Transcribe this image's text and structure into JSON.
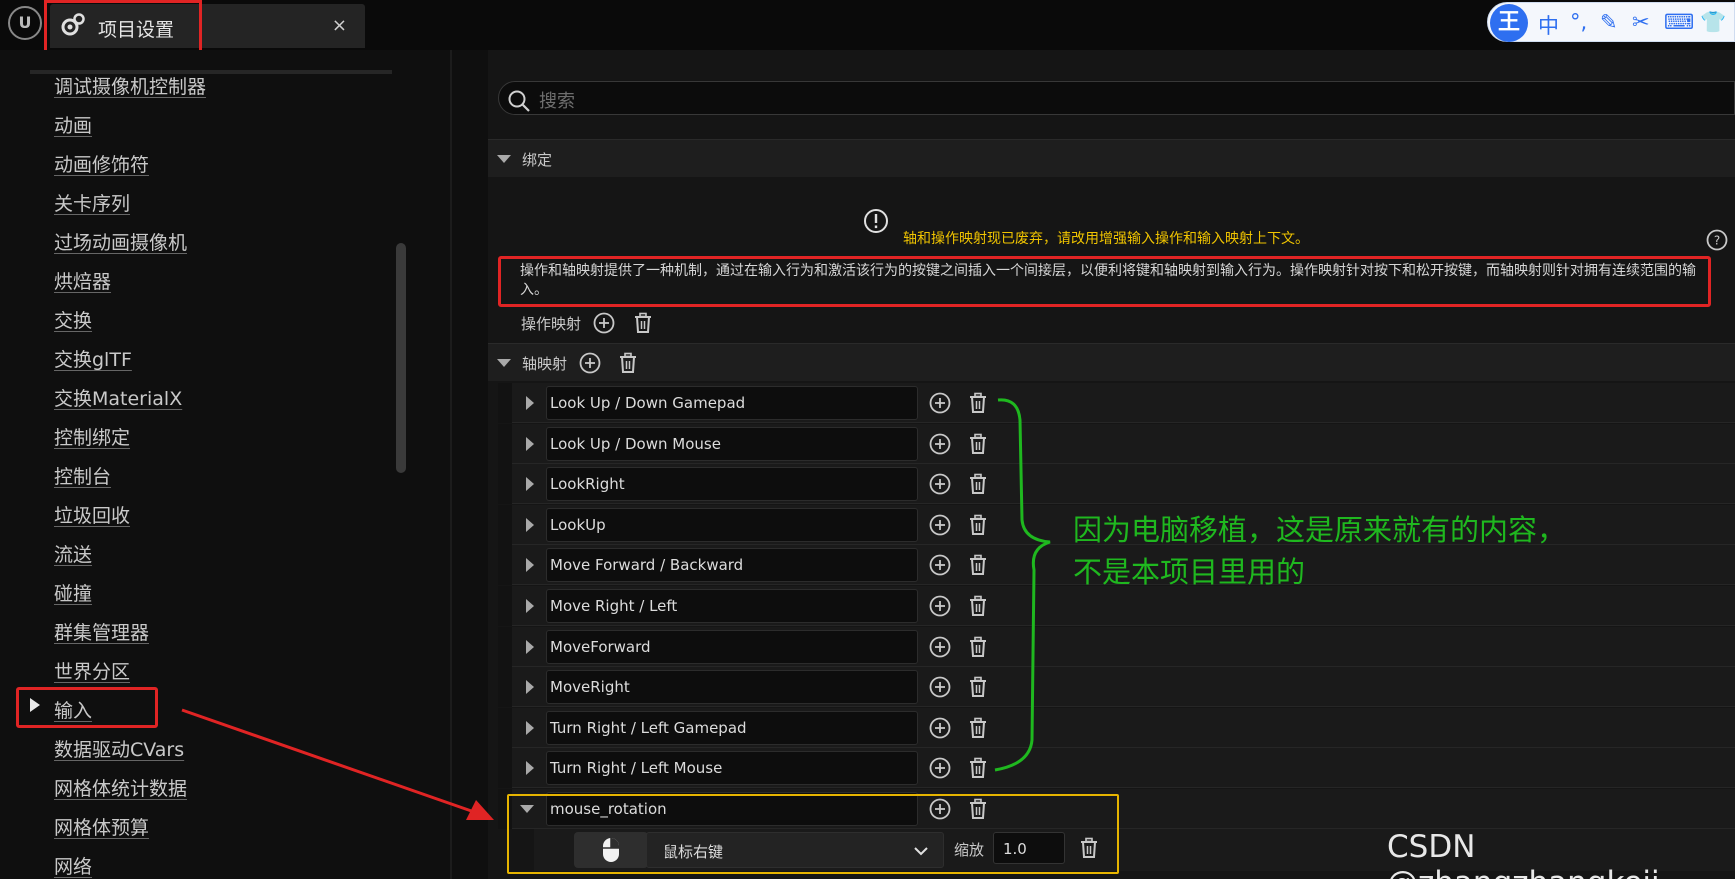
{
  "titlebar": {
    "tab_title": "项目设置",
    "close": "×",
    "logo": "U"
  },
  "ime": {
    "logo": "王",
    "items": [
      "中",
      "°,",
      "✎",
      "✂",
      "⌨",
      "👕"
    ]
  },
  "sidebar": {
    "items": [
      {
        "label": "调试摄像机控制器"
      },
      {
        "label": "动画"
      },
      {
        "label": "动画修饰符"
      },
      {
        "label": "关卡序列"
      },
      {
        "label": "过场动画摄像机"
      },
      {
        "label": "烘焙器"
      },
      {
        "label": "交换"
      },
      {
        "label": "交换glTF"
      },
      {
        "label": "交换MaterialX"
      },
      {
        "label": "控制绑定"
      },
      {
        "label": "控制台"
      },
      {
        "label": "垃圾回收"
      },
      {
        "label": "流送"
      },
      {
        "label": "碰撞"
      },
      {
        "label": "群集管理器"
      },
      {
        "label": "世界分区"
      },
      {
        "label": "输入"
      },
      {
        "label": "数据驱动CVars"
      },
      {
        "label": "网格体统计数据"
      },
      {
        "label": "网格体预算"
      },
      {
        "label": "网络"
      }
    ]
  },
  "search": {
    "placeholder": "搜索"
  },
  "bindings": {
    "header": "绑定",
    "warning": "轴和操作映射现已废弃，请改用增强输入操作和输入映射上下文。",
    "description": "操作和轴映射提供了一种机制，通过在输入行为和激活该行为的按键之间插入一个间接层，以便利将键和轴映射到输入行为。操作映射针对按下和松开按键，而轴映射则针对拥有连续范围的输入。",
    "action_mappings_label": "操作映射",
    "axis_mappings_label": "轴映射",
    "axis_mappings": [
      {
        "name": "Look Up / Down Gamepad"
      },
      {
        "name": "Look Up / Down Mouse"
      },
      {
        "name": "LookRight"
      },
      {
        "name": "LookUp"
      },
      {
        "name": "Move Forward / Backward"
      },
      {
        "name": "Move Right / Left"
      },
      {
        "name": "MoveForward"
      },
      {
        "name": "MoveRight"
      },
      {
        "name": "Turn Right / Left Gamepad"
      },
      {
        "name": "Turn Right / Left Mouse"
      },
      {
        "name": "mouse_rotation"
      }
    ],
    "key_binding": {
      "key": "鼠标右键",
      "scale_label": "缩放",
      "scale_value": "1.0"
    }
  },
  "annotation": {
    "line1": "因为电脑移植，这是原来就有的内容，",
    "line2": "不是本项目里用的"
  },
  "watermark": "CSDN @zhangzhangkeji",
  "colors": {
    "annotation_red": "#e02424",
    "annotation_green": "#1fb81f",
    "highlight_yellow": "#e6b400",
    "warning_yellow": "#f0c400"
  }
}
